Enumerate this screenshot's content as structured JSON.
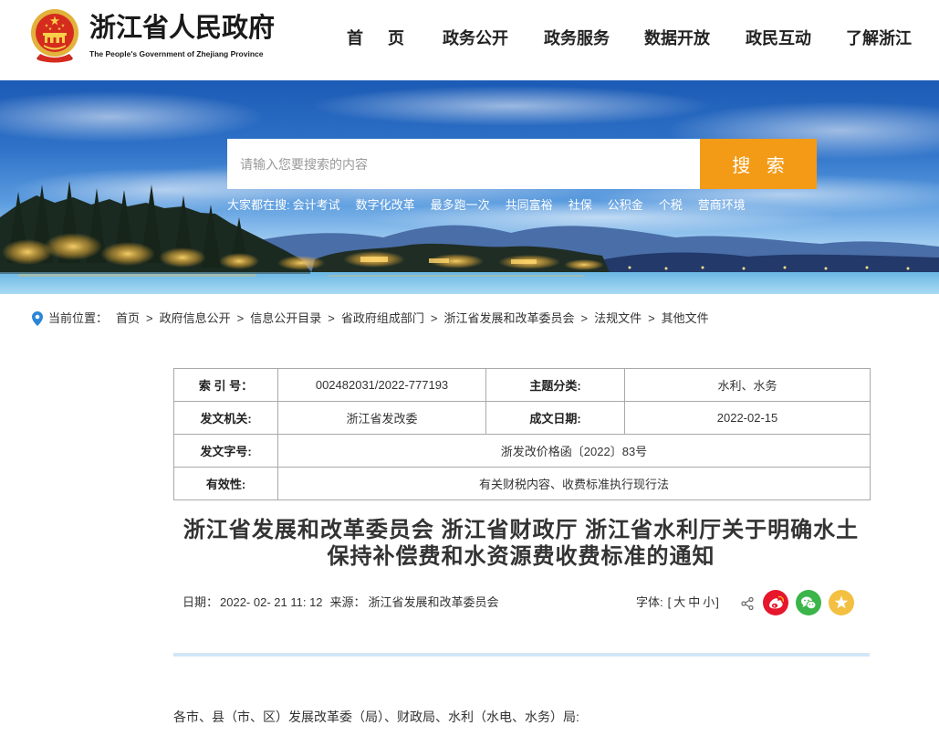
{
  "header": {
    "site_name": "浙江省人民政府",
    "site_name_en": "The People's Government of Zhejiang Province",
    "nav": [
      {
        "label": "首 页"
      },
      {
        "label": "政务公开"
      },
      {
        "label": "政务服务"
      },
      {
        "label": "数据开放"
      },
      {
        "label": "政民互动"
      },
      {
        "label": "了解浙江"
      }
    ]
  },
  "search": {
    "placeholder": "请输入您要搜索的内容",
    "button_label": "搜 索",
    "hot_label": "大家都在搜:",
    "hot_items": [
      "会计考试",
      "数字化改革",
      "最多跑一次",
      "共同富裕",
      "社保",
      "公积金",
      "个税",
      "营商环境"
    ]
  },
  "breadcrumb": {
    "label": "当前位置：",
    "separator": ">",
    "items": [
      "首页",
      "政府信息公开",
      "信息公开目录",
      "省政府组成部门",
      "浙江省发展和改革委员会",
      "法规文件",
      "其他文件"
    ]
  },
  "info_table": {
    "index_no": {
      "label": "索 引 号：",
      "value": "002482031/2022-777193"
    },
    "topic": {
      "label": "主题分类:",
      "value": "水利、水务"
    },
    "issuer": {
      "label": "发文机关:",
      "value": "浙江省发改委"
    },
    "written_date": {
      "label": "成文日期:",
      "value": "2022-02-15"
    },
    "doc_no": {
      "label": "发文字号:",
      "value": "浙发改价格函〔2022〕83号"
    },
    "validity": {
      "label": "有效性:",
      "value": "有关财税内容、收费标准执行现行法"
    }
  },
  "article": {
    "title": "浙江省发展和改革委员会 浙江省财政厅 浙江省水利厅关于明确水土保持补偿费和水资源费收费标准的通知",
    "date_label": "日期：",
    "date": "2022- 02- 21 11: 12",
    "source_label": "来源：",
    "source": "浙江省发展和改革委员会",
    "font_label": "字体:",
    "font_open": "[",
    "font_sizes": [
      "大",
      "中",
      "小"
    ],
    "font_close": "]",
    "body": [
      "各市、县（市、区）发展改革委（局）、财政局、水利（水电、水务）局:"
    ]
  },
  "icons": {
    "emblem": "national-emblem-icon",
    "location": "location-pin-icon",
    "share": [
      "share-icon",
      "weibo-icon",
      "wechat-icon",
      "favorite-star-icon"
    ]
  },
  "colors": {
    "search_button": "#f39a16",
    "divider": "#d3e6f8",
    "location_pin": "#2a86d8",
    "weibo": "#e6162d",
    "wechat": "#3bb54a",
    "favorite": "#f3c042",
    "sky_top": "#1c5bb5"
  }
}
